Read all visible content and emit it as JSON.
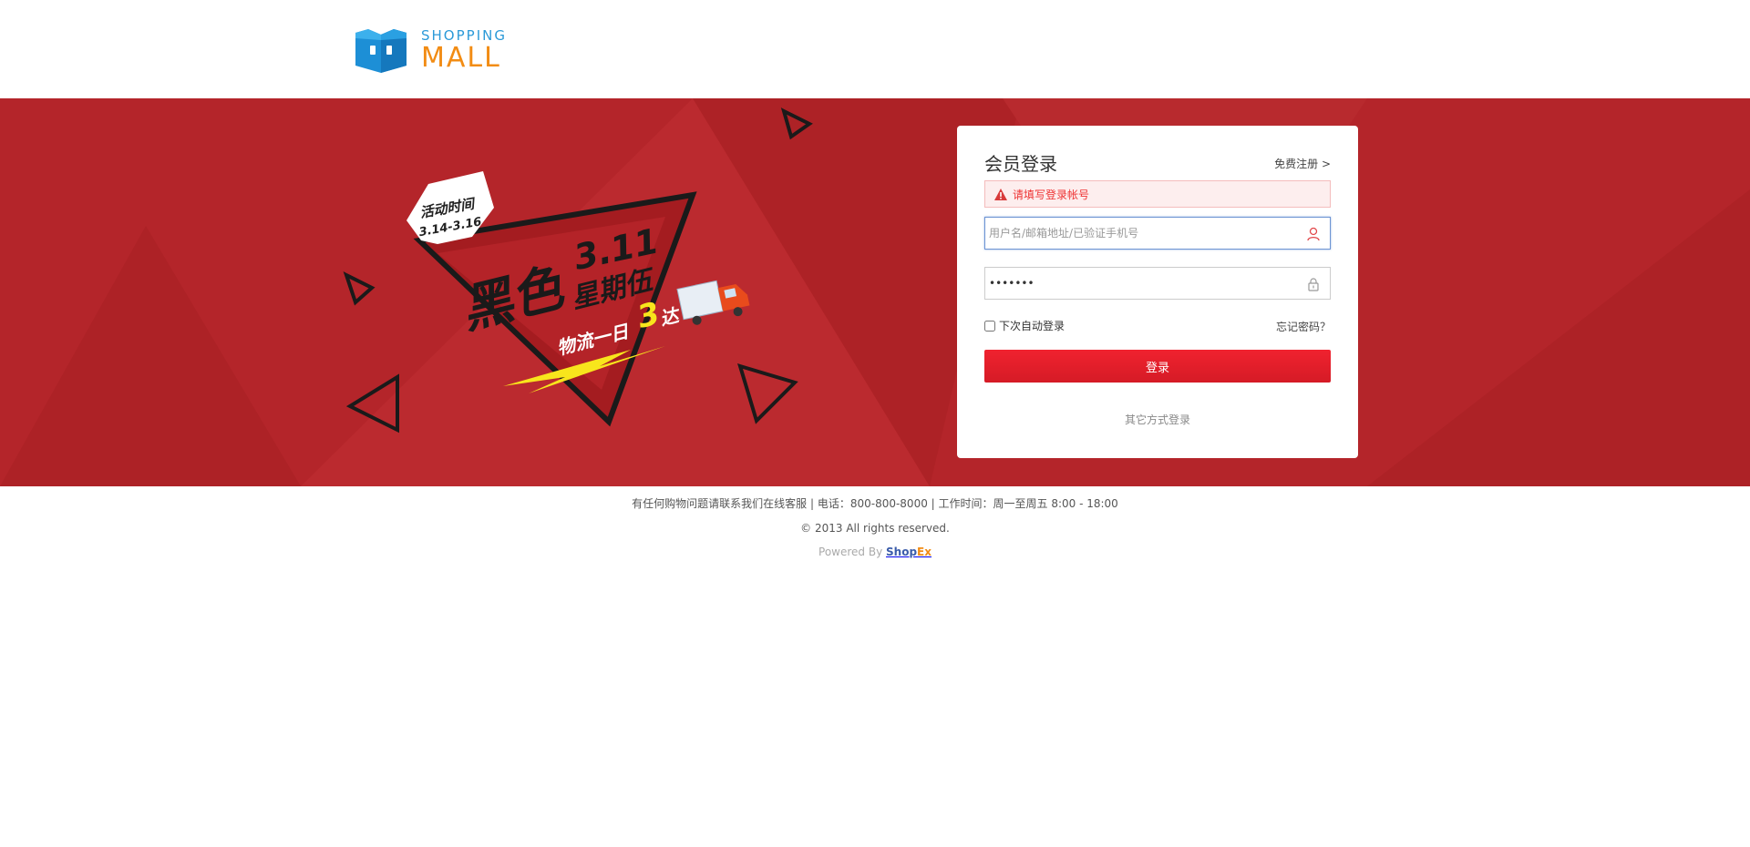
{
  "header": {
    "logo_top": "SHOPPING",
    "logo_bottom": "MALL"
  },
  "banner": {
    "promo_badge_line1": "活动时间",
    "promo_badge_line2": "3.14-3.16",
    "promo_date": "3.11",
    "promo_title_a": "黑色",
    "promo_title_b": "星期伍",
    "promo_logistics": "物流一日",
    "promo_number": "3",
    "promo_logistics_end": "达",
    "background_color": "#b4252a"
  },
  "login": {
    "title": "会员登录",
    "register_link": "免费注册 >",
    "error_message": "请填写登录帐号",
    "username_placeholder": "用户名/邮箱地址/已验证手机号",
    "username_value": "",
    "password_value": "•••••••",
    "remember_label": "下次自动登录",
    "remember_checked": false,
    "forgot_link": "忘记密码？",
    "submit_label": "登录",
    "other_login": "其它方式登录",
    "accent_color": "#e8202c"
  },
  "footer": {
    "contact_line": "有任何购物问题请联系我们在线客服 | 电话：800-800-8000 | 工作时间：周一至周五 8:00 - 18:00",
    "copyright": "© 2013 All rights reserved.",
    "powered_prefix": "Powered By",
    "powered_brand_a": "Shop",
    "powered_brand_b": "Ex"
  },
  "icons": {
    "logo": "shopping-bag-logo-icon",
    "warning": "warning-icon",
    "user": "user-icon",
    "lock": "lock-icon"
  }
}
